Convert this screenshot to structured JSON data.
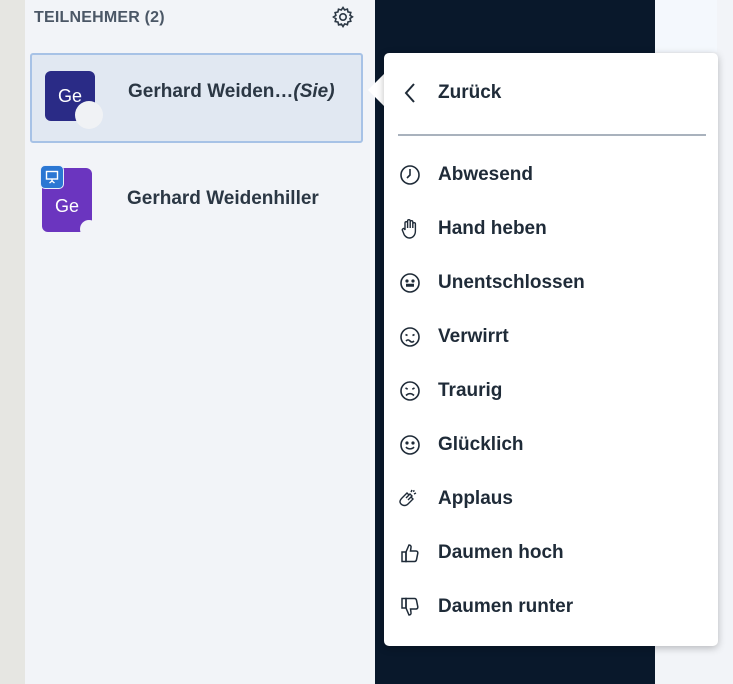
{
  "participants_panel": {
    "header": "TEILNEHMER (2)",
    "settings_icon": "gear-icon",
    "users": [
      {
        "initials": "Ge",
        "name": "Gerhard Weiden…",
        "you_tag": "(Sie)",
        "avatar_color": "#2a2b86"
      },
      {
        "initials": "Ge",
        "name": "Gerhard Weidenhiller",
        "avatar_color": "#6b35bf",
        "presenter_icon": "presentation-icon"
      }
    ]
  },
  "status_menu": {
    "back_label": "Zurück",
    "items": [
      {
        "label": "Abwesend",
        "icon": "clock-icon"
      },
      {
        "label": "Hand heben",
        "icon": "hand-icon"
      },
      {
        "label": "Unentschlossen",
        "icon": "neutral-face-icon"
      },
      {
        "label": "Verwirrt",
        "icon": "confused-face-icon"
      },
      {
        "label": "Traurig",
        "icon": "sad-face-icon"
      },
      {
        "label": "Glücklich",
        "icon": "happy-face-icon"
      },
      {
        "label": "Applaus",
        "icon": "applause-icon"
      },
      {
        "label": "Daumen hoch",
        "icon": "thumbs-up-icon"
      },
      {
        "label": "Daumen runter",
        "icon": "thumbs-down-icon"
      }
    ]
  },
  "colors": {
    "panel_bg": "#f2f4f8",
    "dark_bg": "#09182b",
    "selection_border": "#a7c2e6",
    "presenter_badge": "#2b77d3"
  }
}
